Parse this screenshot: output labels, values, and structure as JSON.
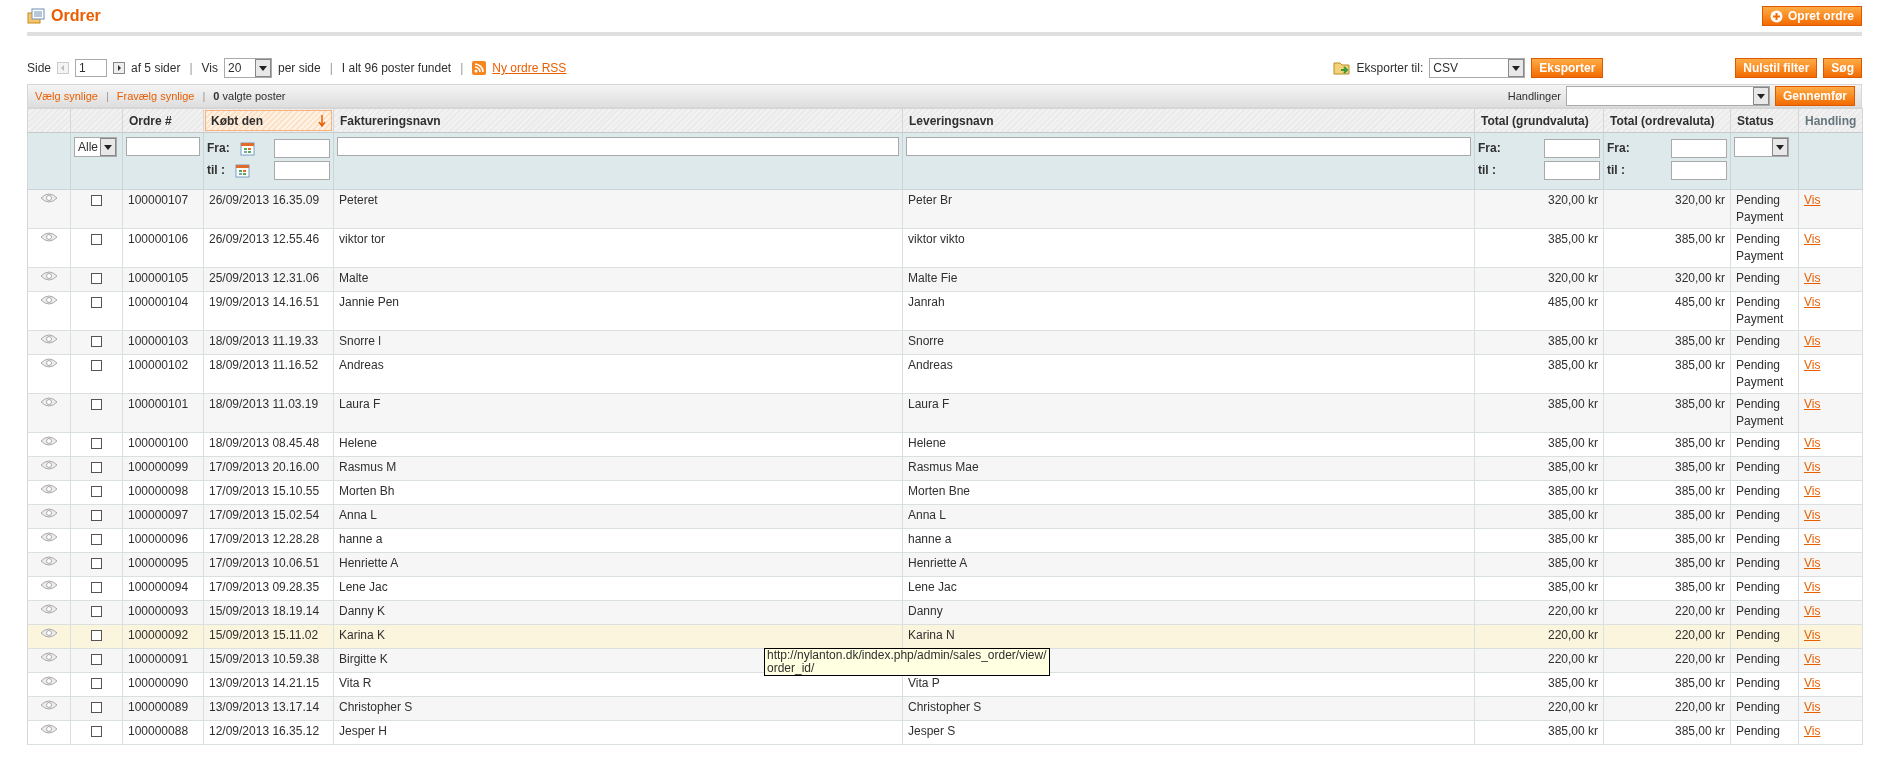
{
  "header": {
    "title": "Ordrer",
    "create_button": "Opret ordre"
  },
  "pager": {
    "page_label": "Side",
    "page": "1",
    "of_pages": "af 5 sider",
    "show_label": "Vis",
    "per_page": "20",
    "per_page_label": "per side",
    "total": "I alt 96 poster fundet",
    "rss_link": "Ny ordre RSS",
    "separators": [
      "|",
      "|",
      "|"
    ]
  },
  "export": {
    "label": "Eksporter til:",
    "format": "CSV",
    "button": "Eksporter"
  },
  "filter_buttons": [
    "Nulstil filter",
    "Søg"
  ],
  "massaction": {
    "select_visible": "Vælg synlige",
    "unselect_visible": "Fravælg synlige",
    "selected_count": "0",
    "selected_label": "valgte poster",
    "actions_label": "Handlinger",
    "submit": "Gennemfør",
    "separators": [
      "|",
      "|"
    ]
  },
  "table": {
    "columns": [
      {
        "kind": "view"
      },
      {
        "kind": "check"
      },
      {
        "kind": "order",
        "label": "Ordre #",
        "sortable": true,
        "sorted": false
      },
      {
        "kind": "date",
        "label": "Købt den",
        "sortable": true,
        "sorted": true
      },
      {
        "kind": "billing",
        "label": "Faktureringsnavn",
        "sortable": true,
        "sorted": false
      },
      {
        "kind": "shipping",
        "label": "Leveringsnavn",
        "sortable": true,
        "sorted": false
      },
      {
        "kind": "money_base",
        "label": "Total (grundvaluta)",
        "sortable": true,
        "sorted": false
      },
      {
        "kind": "money_order",
        "label": "Total (ordrevaluta)",
        "sortable": true,
        "sorted": false
      },
      {
        "kind": "status",
        "label": "Status",
        "sortable": true,
        "sorted": false
      },
      {
        "kind": "action",
        "label": "Handling",
        "sortable": false,
        "sorted": false
      }
    ],
    "filters": [
      {
        "kind": "none"
      },
      {
        "kind": "select",
        "value": "Alle"
      },
      {
        "kind": "text"
      },
      {
        "kind": "date_range",
        "from_label": "Fra:",
        "to_label": "til :"
      },
      {
        "kind": "text"
      },
      {
        "kind": "text"
      },
      {
        "kind": "range",
        "from_label": "Fra:",
        "to_label": "til :"
      },
      {
        "kind": "range",
        "from_label": "Fra:",
        "to_label": "til :"
      },
      {
        "kind": "select"
      },
      {
        "kind": "none"
      }
    ],
    "rows": [
      {
        "order": "100000107",
        "date": "26/09/2013 16.35.09",
        "billing": "Peteret",
        "shipping": "Peter Br",
        "total_base": "320,00 kr",
        "total_order": "320,00 kr",
        "status": "Pending Payment",
        "action": "Vis",
        "checked": false,
        "highlighted": false
      },
      {
        "order": "100000106",
        "date": "26/09/2013 12.55.46",
        "billing": "viktor tor",
        "shipping": "viktor vikto",
        "total_base": "385,00 kr",
        "total_order": "385,00 kr",
        "status": "Pending Payment",
        "action": "Vis",
        "checked": false,
        "highlighted": false
      },
      {
        "order": "100000105",
        "date": "25/09/2013 12.31.06",
        "billing": "Malte",
        "shipping": "Malte Fie",
        "total_base": "320,00 kr",
        "total_order": "320,00 kr",
        "status": "Pending",
        "action": "Vis",
        "checked": false,
        "highlighted": false
      },
      {
        "order": "100000104",
        "date": "19/09/2013 14.16.51",
        "billing": "Jannie Pen",
        "shipping": "Janrah",
        "total_base": "485,00 kr",
        "total_order": "485,00 kr",
        "status": "Pending Payment",
        "action": "Vis",
        "checked": false,
        "highlighted": false
      },
      {
        "order": "100000103",
        "date": "18/09/2013 11.19.33",
        "billing": "Snorre l",
        "shipping": "Snorre",
        "total_base": "385,00 kr",
        "total_order": "385,00 kr",
        "status": "Pending",
        "action": "Vis",
        "checked": false,
        "highlighted": false
      },
      {
        "order": "100000102",
        "date": "18/09/2013 11.16.52",
        "billing": "Andreas",
        "shipping": "Andreas",
        "total_base": "385,00 kr",
        "total_order": "385,00 kr",
        "status": "Pending Payment",
        "action": "Vis",
        "checked": false,
        "highlighted": false
      },
      {
        "order": "100000101",
        "date": "18/09/2013 11.03.19",
        "billing": "Laura F",
        "shipping": "Laura F",
        "total_base": "385,00 kr",
        "total_order": "385,00 kr",
        "status": "Pending Payment",
        "action": "Vis",
        "checked": false,
        "highlighted": false
      },
      {
        "order": "100000100",
        "date": "18/09/2013 08.45.48",
        "billing": "Helene",
        "shipping": "Helene",
        "total_base": "385,00 kr",
        "total_order": "385,00 kr",
        "status": "Pending",
        "action": "Vis",
        "checked": false,
        "highlighted": false
      },
      {
        "order": "100000099",
        "date": "17/09/2013 20.16.00",
        "billing": "Rasmus M",
        "shipping": "Rasmus Mae",
        "total_base": "385,00 kr",
        "total_order": "385,00 kr",
        "status": "Pending",
        "action": "Vis",
        "checked": false,
        "highlighted": false
      },
      {
        "order": "100000098",
        "date": "17/09/2013 15.10.55",
        "billing": "Morten Bh",
        "shipping": "Morten Bne",
        "total_base": "385,00 kr",
        "total_order": "385,00 kr",
        "status": "Pending",
        "action": "Vis",
        "checked": false,
        "highlighted": false
      },
      {
        "order": "100000097",
        "date": "17/09/2013 15.02.54",
        "billing": "Anna L",
        "shipping": "Anna L",
        "total_base": "385,00 kr",
        "total_order": "385,00 kr",
        "status": "Pending",
        "action": "Vis",
        "checked": false,
        "highlighted": false
      },
      {
        "order": "100000096",
        "date": "17/09/2013 12.28.28",
        "billing": "hanne a",
        "shipping": "hanne a",
        "total_base": "385,00 kr",
        "total_order": "385,00 kr",
        "status": "Pending",
        "action": "Vis",
        "checked": false,
        "highlighted": false
      },
      {
        "order": "100000095",
        "date": "17/09/2013 10.06.51",
        "billing": "Henriette A",
        "shipping": "Henriette A",
        "total_base": "385,00 kr",
        "total_order": "385,00 kr",
        "status": "Pending",
        "action": "Vis",
        "checked": false,
        "highlighted": false
      },
      {
        "order": "100000094",
        "date": "17/09/2013 09.28.35",
        "billing": "Lene Jac",
        "shipping": "Lene Jac",
        "total_base": "385,00 kr",
        "total_order": "385,00 kr",
        "status": "Pending",
        "action": "Vis",
        "checked": false,
        "highlighted": false
      },
      {
        "order": "100000093",
        "date": "15/09/2013 18.19.14",
        "billing": "Danny K",
        "shipping": "Danny",
        "total_base": "220,00 kr",
        "total_order": "220,00 kr",
        "status": "Pending",
        "action": "Vis",
        "checked": false,
        "highlighted": false
      },
      {
        "order": "100000092",
        "date": "15/09/2013 15.11.02",
        "billing": "Karina K",
        "shipping": "Karina N",
        "total_base": "220,00 kr",
        "total_order": "220,00 kr",
        "status": "Pending",
        "action": "Vis",
        "checked": false,
        "highlighted": true
      },
      {
        "order": "100000091",
        "date": "15/09/2013 10.59.38",
        "billing": "Birgitte K",
        "total_base": "220,00 kr",
        "total_order": "220,00 kr",
        "status": "Pending",
        "action": "Vis",
        "checked": false,
        "highlighted": false
      },
      {
        "order": "100000090",
        "date": "13/09/2013 14.21.15",
        "billing": "Vita R",
        "shipping": "Vita P",
        "total_base": "385,00 kr",
        "total_order": "385,00 kr",
        "status": "Pending",
        "action": "Vis",
        "checked": false,
        "highlighted": false
      },
      {
        "order": "100000089",
        "date": "13/09/2013 13.17.14",
        "billing": "Christopher S",
        "shipping": "Christopher S",
        "total_base": "220,00 kr",
        "total_order": "220,00 kr",
        "status": "Pending",
        "action": "Vis",
        "checked": false,
        "highlighted": false
      },
      {
        "order": "100000088",
        "date": "12/09/2013 16.35.12",
        "billing": "Jesper H",
        "shipping": "Jesper S",
        "total_base": "385,00 kr",
        "total_order": "385,00 kr",
        "status": "Pending",
        "action": "Vis",
        "checked": false,
        "highlighted": false
      }
    ]
  },
  "tooltip": {
    "lines": [
      "http://nylanton.dk/index.php/admin/sales_order/view/",
      "order_id/"
    ]
  }
}
